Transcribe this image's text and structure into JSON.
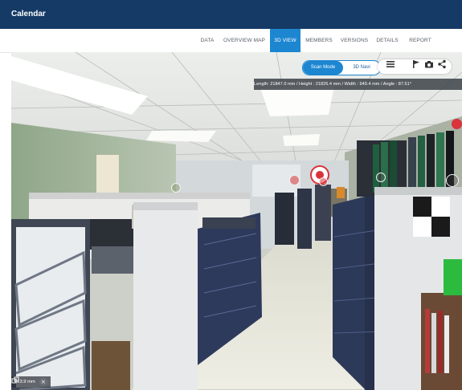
{
  "header": {
    "app_title": "Calendar"
  },
  "tabs": [
    {
      "label": "DATA",
      "active": false
    },
    {
      "label": "OVERVIEW MAP",
      "active": false
    },
    {
      "label": "3D VIEW",
      "active": true
    },
    {
      "label": "MEMBERS",
      "active": false
    },
    {
      "label": "VERSIONS",
      "active": false
    },
    {
      "label": "DETAILS",
      "active": false
    },
    {
      "label": "REPORT",
      "active": false
    }
  ],
  "viewer": {
    "mode_toggle": {
      "active": "Scan Mode",
      "inactive": "3D Navi"
    },
    "toolbar_icons": [
      "list-icon",
      "flag-icon",
      "camera-icon",
      "share-icon"
    ],
    "measurement": "Length: 21847.0 mm  /  Height : 21826.4 mm  /  Width : 949.4 mm  /  Angle : 87.51°",
    "scale_readout": "213.9 mm",
    "scale_icons": [
      "copy-icon",
      "close-icon"
    ]
  },
  "colors": {
    "header_bg": "#163a66",
    "accent": "#1c86d1",
    "hotspot_red": "#d9343b"
  }
}
